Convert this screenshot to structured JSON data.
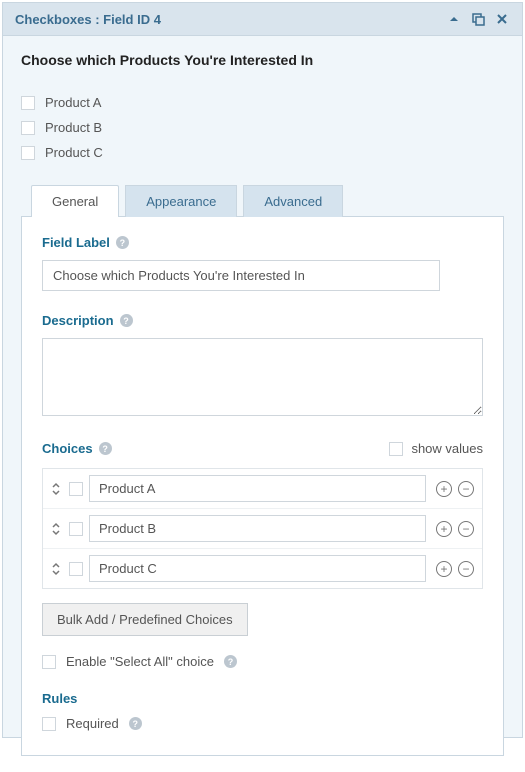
{
  "header": {
    "title": "Checkboxes : Field ID 4"
  },
  "preview": {
    "title": "Choose which Products You're Interested In",
    "options": [
      "Product A",
      "Product B",
      "Product C"
    ]
  },
  "tabs": {
    "general": "General",
    "appearance": "Appearance",
    "advanced": "Advanced"
  },
  "general": {
    "fieldLabel": {
      "label": "Field Label",
      "value": "Choose which Products You're Interested In"
    },
    "description": {
      "label": "Description",
      "value": ""
    },
    "choices": {
      "label": "Choices",
      "showValuesLabel": "show values",
      "items": [
        "Product A",
        "Product B",
        "Product C"
      ],
      "bulkButton": "Bulk Add / Predefined Choices"
    },
    "selectAll": {
      "label": "Enable \"Select All\" choice"
    },
    "rules": {
      "label": "Rules",
      "required": "Required"
    }
  }
}
